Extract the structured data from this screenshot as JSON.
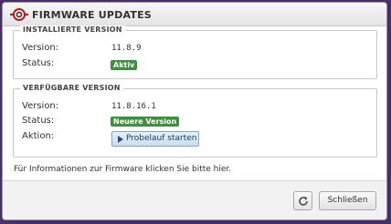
{
  "dialog": {
    "title": "FIRMWARE UPDATES",
    "logo_icon": "circle-o-logo-icon"
  },
  "installed": {
    "legend": "INSTALLIERTE VERSION",
    "version_label": "Version:",
    "version_value": "11.8.9",
    "status_label": "Status:",
    "status_badge": "Aktiv"
  },
  "available": {
    "legend": "VERFÜGBARE VERSION",
    "version_label": "Version:",
    "version_value": "11.8.16.1",
    "status_label": "Status:",
    "status_badge": "Neuere Version",
    "action_label": "Aktion:",
    "action_button": "Probelauf starten",
    "action_icon": "play-icon"
  },
  "info_text": "Für Informationen zur Firmware klicken Sie bitte hier.",
  "footer": {
    "refresh_icon": "refresh-icon",
    "close_button": "Schließen"
  },
  "colors": {
    "badge_green": "#3f8f3f",
    "logo_red": "#c0141e",
    "button_blue": "#c9ddf1"
  }
}
